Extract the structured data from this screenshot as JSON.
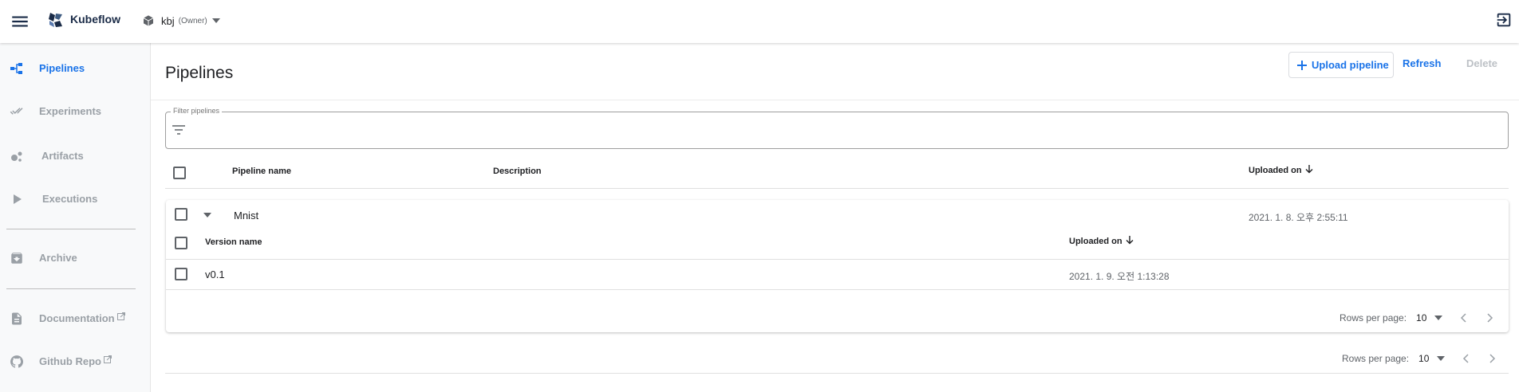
{
  "app": {
    "brand": "Kubeflow",
    "namespace": "kbj",
    "namespace_role": "(Owner)"
  },
  "colors": {
    "accent": "#1a73e8",
    "disabled": "#bdc1c6",
    "sidebar_bg": "#f8f9fa"
  },
  "sidebar": {
    "items": [
      {
        "label": "Pipelines",
        "icon": "pipelines-icon",
        "active": true
      },
      {
        "label": "Experiments",
        "icon": "experiments-icon",
        "active": false
      },
      {
        "label": "Artifacts",
        "icon": "artifacts-icon",
        "active": false
      },
      {
        "label": "Executions",
        "icon": "executions-icon",
        "active": false
      },
      {
        "label": "Archive",
        "icon": "archive-icon",
        "active": false
      },
      {
        "label": "Documentation",
        "icon": "documentation-icon",
        "active": false,
        "external": true
      },
      {
        "label": "Github Repo",
        "icon": "github-icon",
        "active": false,
        "external": true
      }
    ]
  },
  "page": {
    "title": "Pipelines",
    "toolbar": {
      "upload_label": "Upload pipeline",
      "refresh_label": "Refresh",
      "delete_label": "Delete"
    }
  },
  "filter": {
    "label": "Filter pipelines",
    "value": ""
  },
  "table": {
    "columns": {
      "name": "Pipeline name",
      "description": "Description",
      "uploaded": "Uploaded on"
    },
    "rows": [
      {
        "name": "Mnist",
        "description": "",
        "uploaded": "2021. 1. 8. 오후 2:55:11",
        "versions": {
          "columns": {
            "name": "Version name",
            "uploaded": "Uploaded on"
          },
          "rows": [
            {
              "name": "v0.1",
              "uploaded": "2021. 1. 9. 오전 1:13:28"
            }
          ],
          "pagination": {
            "rows_label": "Rows per page:",
            "rows_value": "10"
          }
        }
      }
    ],
    "pagination": {
      "rows_label": "Rows per page:",
      "rows_value": "10"
    }
  }
}
